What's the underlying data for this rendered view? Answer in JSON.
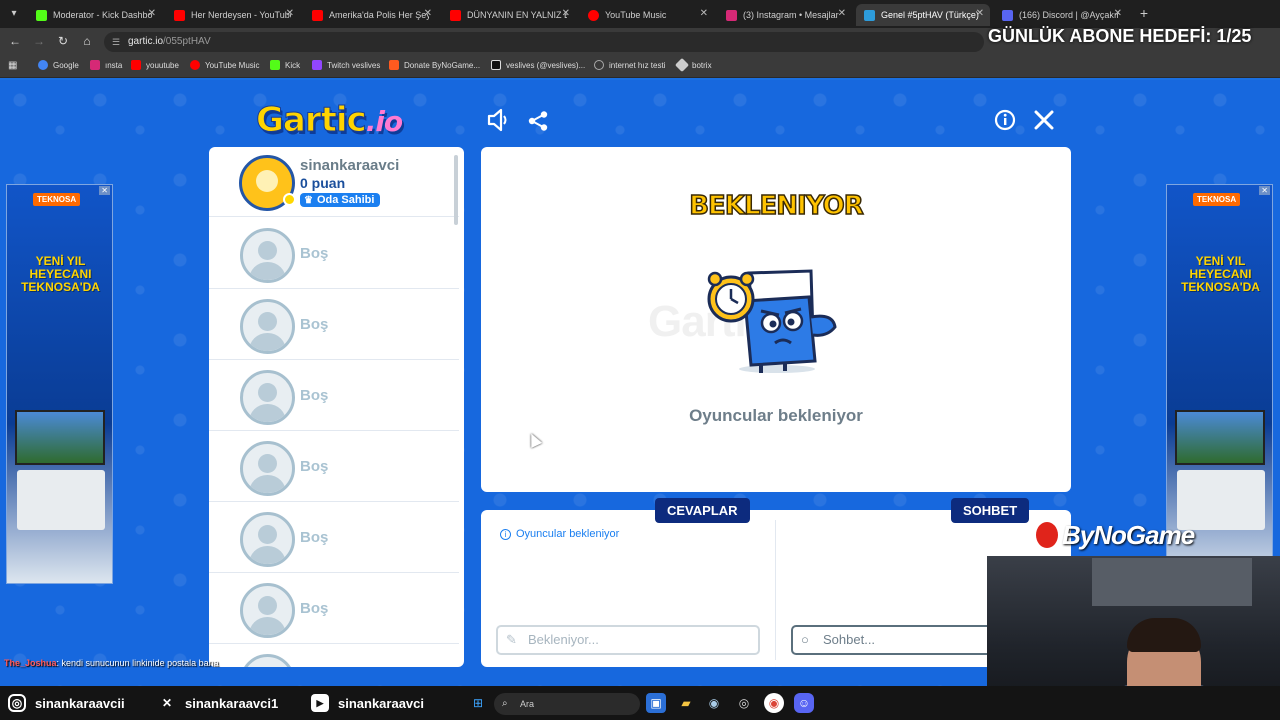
{
  "browser": {
    "tabs": [
      {
        "label": "Moderator - Kick Dashbo",
        "color": "#53fc18",
        "active": false
      },
      {
        "label": "Her Nerdeysen - YouTube",
        "color": "#ff0000",
        "active": false
      },
      {
        "label": "Amerika'da Polis Her Şey",
        "color": "#ff0000",
        "active": false
      },
      {
        "label": "DÜNYANIN EN YALNIZ E",
        "color": "#ff0000",
        "active": false
      },
      {
        "label": "YouTube Music",
        "color": "#ff0000",
        "active": false
      },
      {
        "label": "(3) Instagram • Mesajlar",
        "color": "#d62976",
        "active": false
      },
      {
        "label": "Genel #5ptHAV (Türkçe)",
        "color": "#2d9cdb",
        "active": true
      },
      {
        "label": "(166) Discord | @Ayçakır",
        "color": "#5865f2",
        "active": false
      }
    ],
    "url_domain": "gartic.io",
    "url_path": "/055ptHAV",
    "bookmarks": [
      {
        "label": "Google",
        "color": "#4285f4"
      },
      {
        "label": "ınsta",
        "color": "#d62976"
      },
      {
        "label": "youutube",
        "color": "#ff0000"
      },
      {
        "label": "YouTube Music",
        "color": "#ff0000"
      },
      {
        "label": "Kick",
        "color": "#53fc18"
      },
      {
        "label": "Twitch veslives",
        "color": "#9146ff"
      },
      {
        "label": "Donate ByNoGame...",
        "color": "#ff5a1f"
      },
      {
        "label": "veslives (@veslives)...",
        "color": "#ffffff"
      },
      {
        "label": "internet hız testi",
        "color": "#888888"
      },
      {
        "label": "botrix",
        "color": "#cccccc"
      }
    ]
  },
  "overlay": {
    "goal_text": "GÜNLÜK ABONE HEDEFİ: 1/25",
    "brand": "ByNoGame",
    "chat_user": "The_Joshua",
    "chat_message": ": kendi sunucunun linkinide postala bana"
  },
  "game": {
    "logo_main": "Gartic",
    "logo_suffix": ".io",
    "owner": {
      "name": "sinankaraavci",
      "points": "0 puan",
      "badge": "Oda Sahibi"
    },
    "empty_slots": [
      "Boş",
      "Boş",
      "Boş",
      "Boş",
      "Boş",
      "Boş"
    ],
    "status_title": "BEKLENIYOR",
    "watermark": "Gartic.io",
    "status_text": "Oyuncular bekleniyor",
    "answers_tab": "CEVAPLAR",
    "chat_tab": "SOHBET",
    "answers_info": "Oyuncular bekleniyor",
    "answer_placeholder": "Bekleniyor...",
    "chat_placeholder": "Sohbet..."
  },
  "ads": {
    "brand": "TEKNOSA",
    "headline": "YENİ YIL HEYECANI TEKNOSA'DA"
  },
  "social": [
    {
      "platform": "instagram-icon",
      "handle": "sinankaraavcii"
    },
    {
      "platform": "x-icon",
      "handle": "sinankaraavci1"
    },
    {
      "platform": "youtube-icon",
      "handle": "sinankaraavci"
    }
  ],
  "taskbar": {
    "search_placeholder": "Ara"
  }
}
